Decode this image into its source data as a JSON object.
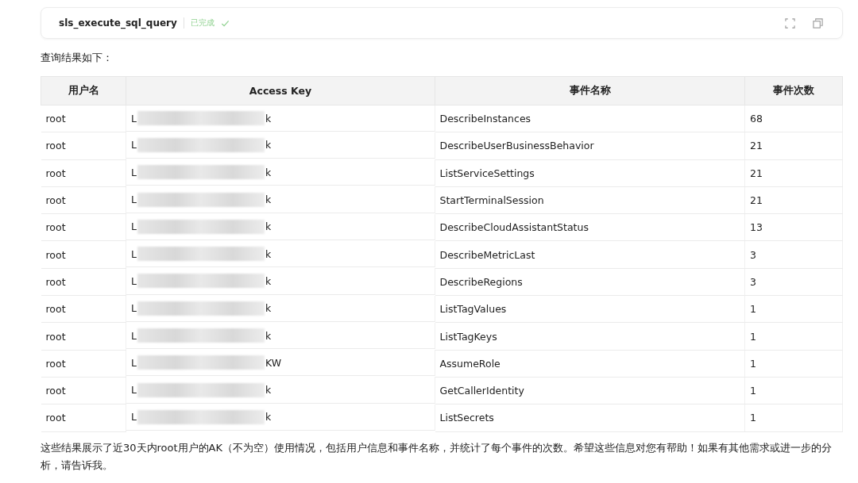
{
  "tool_call": {
    "name": "sls_execute_sql_query",
    "status": "已完成",
    "done": true
  },
  "intro": "查询结果如下：",
  "table": {
    "columns": [
      "用户名",
      "Access Key",
      "事件名称",
      "事件次数"
    ],
    "rows": [
      {
        "user": "root",
        "key_start": "L",
        "key_end": "k",
        "event": "DescribeInstances",
        "count": "68"
      },
      {
        "user": "root",
        "key_start": "L",
        "key_end": "k",
        "event": "DescribeUserBusinessBehavior",
        "count": "21"
      },
      {
        "user": "root",
        "key_start": "L",
        "key_end": "k",
        "event": "ListServiceSettings",
        "count": "21"
      },
      {
        "user": "root",
        "key_start": "L",
        "key_end": "k",
        "event": "StartTerminalSession",
        "count": "21"
      },
      {
        "user": "root",
        "key_start": "L",
        "key_end": "k",
        "event": "DescribeCloudAssistantStatus",
        "count": "13"
      },
      {
        "user": "root",
        "key_start": "L",
        "key_end": "k",
        "event": "DescribeMetricLast",
        "count": "3"
      },
      {
        "user": "root",
        "key_start": "L",
        "key_end": "k",
        "event": "DescribeRegions",
        "count": "3"
      },
      {
        "user": "root",
        "key_start": "L",
        "key_end": "k",
        "event": "ListTagValues",
        "count": "1"
      },
      {
        "user": "root",
        "key_start": "L",
        "key_end": "k",
        "event": "ListTagKeys",
        "count": "1"
      },
      {
        "user": "root",
        "key_start": "L",
        "key_end": "KW",
        "event": "AssumeRole",
        "count": "1"
      },
      {
        "user": "root",
        "key_start": "L",
        "key_end": "k",
        "event": "GetCallerIdentity",
        "count": "1"
      },
      {
        "user": "root",
        "key_start": "L",
        "key_end": "k",
        "event": "ListSecrets",
        "count": "1"
      }
    ]
  },
  "summary": "这些结果展示了近30天内root用户的AK（不为空）使用情况，包括用户信息和事件名称，并统计了每个事件的次数。希望这些信息对您有帮助！如果有其他需求或进一步的分析，请告诉我。"
}
